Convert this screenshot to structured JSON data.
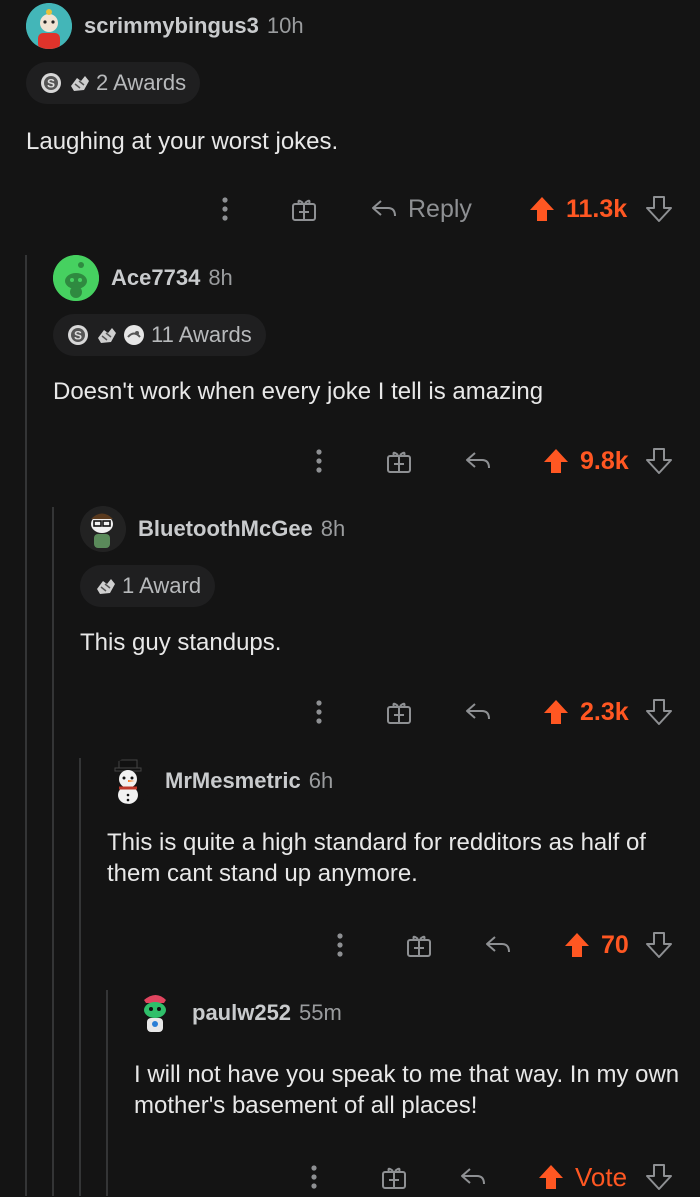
{
  "comments": [
    {
      "username": "scrimmybingus3",
      "age": "10h",
      "awards_label": "2 Awards",
      "award_icons": [
        "silver-award-icon",
        "wholesome-hands-icon"
      ],
      "text": "Laughing at your worst jokes.",
      "reply_label": "Reply",
      "score": "11.3k"
    },
    {
      "username": "Ace7734",
      "age": "8h",
      "awards_label": "11 Awards",
      "award_icons": [
        "silver-award-icon",
        "wholesome-hands-icon",
        "helpful-award-icon"
      ],
      "text": "Doesn't work when every joke I tell is amazing",
      "score": "9.8k"
    },
    {
      "username": "BluetoothMcGee",
      "age": "8h",
      "awards_label": "1 Award",
      "award_icons": [
        "wholesome-hands-icon"
      ],
      "text": "This guy standups.",
      "score": "2.3k"
    },
    {
      "username": "MrMesmetric",
      "age": "6h",
      "text": "This is quite a high standard for redditors as half of them cant stand up anymore.",
      "score": "70"
    },
    {
      "username": "paulw252",
      "age": "55m",
      "text": "I will not have you speak to me that way. In my own mother's basement of all places!",
      "score": "Vote"
    }
  ],
  "colors": {
    "background": "#141414",
    "upvote": "#ff5722",
    "muted": "#8e9093",
    "thread_line": "#343536"
  }
}
